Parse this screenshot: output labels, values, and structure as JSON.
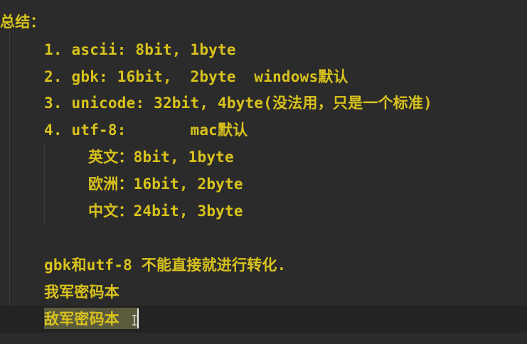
{
  "editor": {
    "lines": [
      "总结：",
      "1. ascii: 8bit, 1byte",
      "2. gbk: 16bit,  2byte  windows默认",
      "3. unicode: 32bit, 4byte(没法用，只是一个标准)",
      "4. utf-8:       mac默认",
      "英文：8bit, 1byte",
      "欧洲：16bit, 2byte",
      "中文：24bit, 3byte",
      "gbk和utf-8 不能直接就进行转化.",
      "我军密码本",
      "敌军密码本"
    ]
  },
  "colors": {
    "background": "#2b2b2b",
    "text": "#d9c21d",
    "current_line": "#232323",
    "selection": "#5a5a3d"
  }
}
